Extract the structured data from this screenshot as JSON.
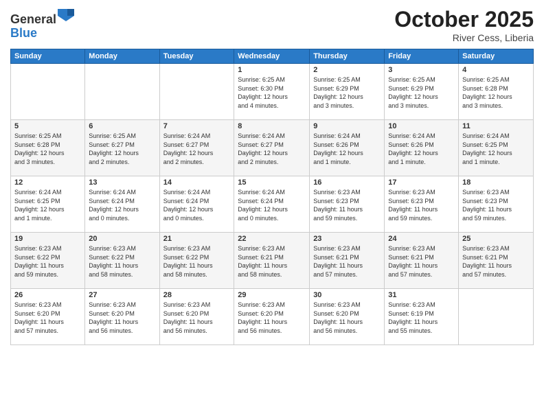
{
  "header": {
    "logo_line1": "General",
    "logo_line2": "Blue",
    "month_title": "October 2025",
    "subtitle": "River Cess, Liberia"
  },
  "weekdays": [
    "Sunday",
    "Monday",
    "Tuesday",
    "Wednesday",
    "Thursday",
    "Friday",
    "Saturday"
  ],
  "weeks": [
    [
      {
        "day": "",
        "info": ""
      },
      {
        "day": "",
        "info": ""
      },
      {
        "day": "",
        "info": ""
      },
      {
        "day": "1",
        "info": "Sunrise: 6:25 AM\nSunset: 6:30 PM\nDaylight: 12 hours\nand 4 minutes."
      },
      {
        "day": "2",
        "info": "Sunrise: 6:25 AM\nSunset: 6:29 PM\nDaylight: 12 hours\nand 3 minutes."
      },
      {
        "day": "3",
        "info": "Sunrise: 6:25 AM\nSunset: 6:29 PM\nDaylight: 12 hours\nand 3 minutes."
      },
      {
        "day": "4",
        "info": "Sunrise: 6:25 AM\nSunset: 6:28 PM\nDaylight: 12 hours\nand 3 minutes."
      }
    ],
    [
      {
        "day": "5",
        "info": "Sunrise: 6:25 AM\nSunset: 6:28 PM\nDaylight: 12 hours\nand 3 minutes."
      },
      {
        "day": "6",
        "info": "Sunrise: 6:25 AM\nSunset: 6:27 PM\nDaylight: 12 hours\nand 2 minutes."
      },
      {
        "day": "7",
        "info": "Sunrise: 6:24 AM\nSunset: 6:27 PM\nDaylight: 12 hours\nand 2 minutes."
      },
      {
        "day": "8",
        "info": "Sunrise: 6:24 AM\nSunset: 6:27 PM\nDaylight: 12 hours\nand 2 minutes."
      },
      {
        "day": "9",
        "info": "Sunrise: 6:24 AM\nSunset: 6:26 PM\nDaylight: 12 hours\nand 1 minute."
      },
      {
        "day": "10",
        "info": "Sunrise: 6:24 AM\nSunset: 6:26 PM\nDaylight: 12 hours\nand 1 minute."
      },
      {
        "day": "11",
        "info": "Sunrise: 6:24 AM\nSunset: 6:25 PM\nDaylight: 12 hours\nand 1 minute."
      }
    ],
    [
      {
        "day": "12",
        "info": "Sunrise: 6:24 AM\nSunset: 6:25 PM\nDaylight: 12 hours\nand 1 minute."
      },
      {
        "day": "13",
        "info": "Sunrise: 6:24 AM\nSunset: 6:24 PM\nDaylight: 12 hours\nand 0 minutes."
      },
      {
        "day": "14",
        "info": "Sunrise: 6:24 AM\nSunset: 6:24 PM\nDaylight: 12 hours\nand 0 minutes."
      },
      {
        "day": "15",
        "info": "Sunrise: 6:24 AM\nSunset: 6:24 PM\nDaylight: 12 hours\nand 0 minutes."
      },
      {
        "day": "16",
        "info": "Sunrise: 6:23 AM\nSunset: 6:23 PM\nDaylight: 11 hours\nand 59 minutes."
      },
      {
        "day": "17",
        "info": "Sunrise: 6:23 AM\nSunset: 6:23 PM\nDaylight: 11 hours\nand 59 minutes."
      },
      {
        "day": "18",
        "info": "Sunrise: 6:23 AM\nSunset: 6:23 PM\nDaylight: 11 hours\nand 59 minutes."
      }
    ],
    [
      {
        "day": "19",
        "info": "Sunrise: 6:23 AM\nSunset: 6:22 PM\nDaylight: 11 hours\nand 59 minutes."
      },
      {
        "day": "20",
        "info": "Sunrise: 6:23 AM\nSunset: 6:22 PM\nDaylight: 11 hours\nand 58 minutes."
      },
      {
        "day": "21",
        "info": "Sunrise: 6:23 AM\nSunset: 6:22 PM\nDaylight: 11 hours\nand 58 minutes."
      },
      {
        "day": "22",
        "info": "Sunrise: 6:23 AM\nSunset: 6:21 PM\nDaylight: 11 hours\nand 58 minutes."
      },
      {
        "day": "23",
        "info": "Sunrise: 6:23 AM\nSunset: 6:21 PM\nDaylight: 11 hours\nand 57 minutes."
      },
      {
        "day": "24",
        "info": "Sunrise: 6:23 AM\nSunset: 6:21 PM\nDaylight: 11 hours\nand 57 minutes."
      },
      {
        "day": "25",
        "info": "Sunrise: 6:23 AM\nSunset: 6:21 PM\nDaylight: 11 hours\nand 57 minutes."
      }
    ],
    [
      {
        "day": "26",
        "info": "Sunrise: 6:23 AM\nSunset: 6:20 PM\nDaylight: 11 hours\nand 57 minutes."
      },
      {
        "day": "27",
        "info": "Sunrise: 6:23 AM\nSunset: 6:20 PM\nDaylight: 11 hours\nand 56 minutes."
      },
      {
        "day": "28",
        "info": "Sunrise: 6:23 AM\nSunset: 6:20 PM\nDaylight: 11 hours\nand 56 minutes."
      },
      {
        "day": "29",
        "info": "Sunrise: 6:23 AM\nSunset: 6:20 PM\nDaylight: 11 hours\nand 56 minutes."
      },
      {
        "day": "30",
        "info": "Sunrise: 6:23 AM\nSunset: 6:20 PM\nDaylight: 11 hours\nand 56 minutes."
      },
      {
        "day": "31",
        "info": "Sunrise: 6:23 AM\nSunset: 6:19 PM\nDaylight: 11 hours\nand 55 minutes."
      },
      {
        "day": "",
        "info": ""
      }
    ]
  ]
}
